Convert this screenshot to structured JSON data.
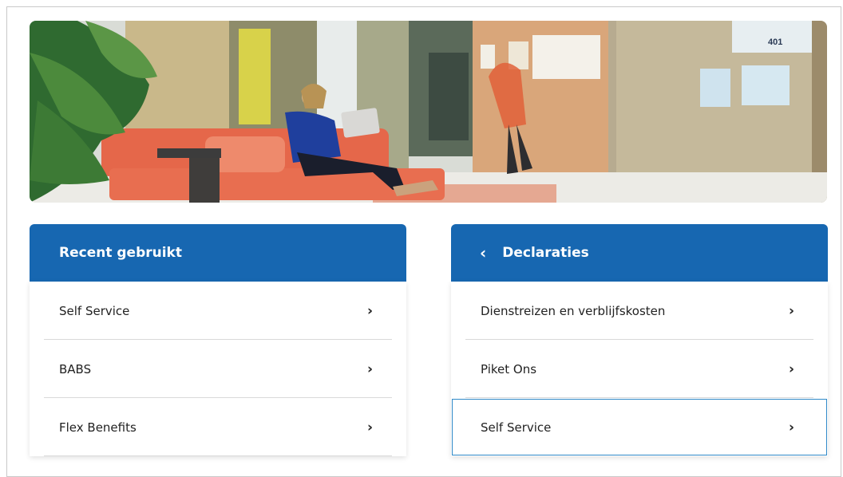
{
  "hero": {
    "room_number": "401"
  },
  "recent_panel": {
    "title": "Recent gebruikt",
    "items": [
      {
        "label": "Self Service",
        "chevron": "›"
      },
      {
        "label": "BABS",
        "chevron": "›"
      },
      {
        "label": "Flex Benefits",
        "chevron": "›"
      }
    ]
  },
  "declarations_panel": {
    "back_icon": "‹",
    "title": "Declaraties",
    "items": [
      {
        "label": "Dienstreizen en verblijfskosten",
        "chevron": "›"
      },
      {
        "label": "Piket Ons",
        "chevron": "›"
      },
      {
        "label": "Self Service",
        "chevron": "›"
      }
    ]
  },
  "colors": {
    "header_blue": "#1767b1",
    "focus_outline": "#2f89c8",
    "sofa_orange": "#e5674a"
  },
  "icons": {
    "list_chevron": "chevron-right-icon",
    "back": "chevron-left-icon"
  }
}
